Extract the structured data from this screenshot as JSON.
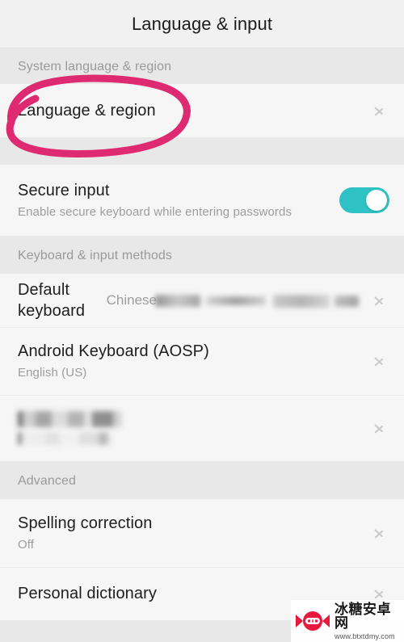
{
  "header": {
    "title": "Language & input"
  },
  "sections": [
    {
      "header": "System language & region",
      "rows": [
        {
          "title": "Language & region",
          "type": "link",
          "icon": "chevron-right-icon"
        }
      ]
    },
    {
      "header": "",
      "rows": [
        {
          "title": "Secure input",
          "subtitle": "Enable secure keyboard while entering passwords",
          "type": "toggle",
          "toggle_on": true
        }
      ]
    },
    {
      "header": "Keyboard & input methods",
      "rows": [
        {
          "title": "Default keyboard",
          "value": "Chinese",
          "value_redacted": true,
          "type": "link",
          "icon": "chevron-right-icon"
        },
        {
          "title": "Android Keyboard (AOSP)",
          "subtitle": "English (US)",
          "type": "link",
          "icon": "chevron-right-icon"
        },
        {
          "title": "",
          "subtitle": "",
          "redacted": true,
          "type": "link",
          "icon": "chevron-right-icon"
        }
      ]
    },
    {
      "header": "Advanced",
      "rows": [
        {
          "title": "Spelling correction",
          "subtitle": "Off",
          "type": "link",
          "icon": "chevron-right-icon"
        },
        {
          "title": "Personal dictionary",
          "type": "link",
          "icon": "chevron-right-icon"
        }
      ]
    }
  ],
  "annotation": {
    "shape": "hand-drawn-ellipse",
    "target": "Language & region",
    "color": "#de2a70"
  },
  "watermark": {
    "site_name": "冰糖安卓网",
    "url": "www.btxtdmy.com",
    "logo_color": "#e8193c"
  },
  "colors": {
    "toggle_on": "#2fc2c4",
    "annotation_pink": "#de2a70",
    "row_background": "#f6f6f6",
    "section_background": "#e8e8e8",
    "title_background": "#f1f1f1",
    "primary_text": "#1e1e1e",
    "secondary_text": "#9d9d9d",
    "chevron": "#c9c9c9"
  }
}
